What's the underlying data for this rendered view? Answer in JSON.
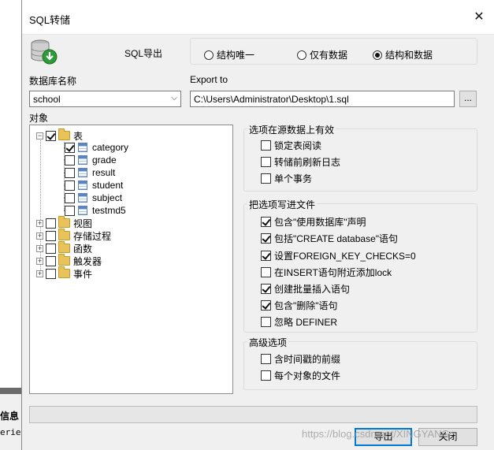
{
  "background": {
    "info_label": "信息",
    "text": "erie"
  },
  "window": {
    "title": "SQL转储"
  },
  "header": {
    "sql_export_label": "SQL导出",
    "radios": [
      {
        "label": "结构唯一",
        "selected": false
      },
      {
        "label": "仅有数据",
        "selected": false
      },
      {
        "label": "结构和数据",
        "selected": true
      }
    ]
  },
  "database": {
    "label": "数据库名称",
    "value": "school"
  },
  "export": {
    "label": "Export to",
    "path": "C:\\Users\\Administrator\\Desktop\\1.sql",
    "browse_label": "..."
  },
  "objects": {
    "label": "对象",
    "tree": [
      {
        "label": "表",
        "checked": true,
        "expanded": true,
        "children": [
          {
            "label": "category",
            "checked": true
          },
          {
            "label": "grade",
            "checked": false
          },
          {
            "label": "result",
            "checked": false
          },
          {
            "label": "student",
            "checked": false
          },
          {
            "label": "subject",
            "checked": false
          },
          {
            "label": "testmd5",
            "checked": false
          }
        ]
      },
      {
        "label": "视图",
        "checked": false
      },
      {
        "label": "存储过程",
        "checked": false
      },
      {
        "label": "函数",
        "checked": false
      },
      {
        "label": "触发器",
        "checked": false
      },
      {
        "label": "事件",
        "checked": false
      }
    ]
  },
  "source_options": {
    "title": "选项在源数据上有效",
    "items": [
      {
        "label": "锁定表阅读",
        "checked": false
      },
      {
        "label": "转储前刷新日志",
        "checked": false
      },
      {
        "label": "单个事务",
        "checked": false
      }
    ]
  },
  "file_options": {
    "title": "把选项写进文件",
    "items": [
      {
        "label": "包含\"使用数据库\"声明",
        "checked": true
      },
      {
        "label": "包括\"CREATE database\"语句",
        "checked": true
      },
      {
        "label": "设置FOREIGN_KEY_CHECKS=0",
        "checked": true
      },
      {
        "label": "在INSERT语句附近添加lock",
        "checked": false
      },
      {
        "label": "创建批量插入语句",
        "checked": true
      },
      {
        "label": "包含\"删除\"语句",
        "checked": true
      },
      {
        "label": "忽略 DEFINER",
        "checked": false
      }
    ]
  },
  "advanced_options": {
    "title": "高级选项",
    "items": [
      {
        "label": "含时间戳的前缀",
        "checked": false
      },
      {
        "label": "每个对象的文件",
        "checked": false
      }
    ]
  },
  "footer": {
    "export_label": "导出",
    "close_label": "关闭"
  },
  "watermark": "https://blog.csdn.net/XINGYANG"
}
